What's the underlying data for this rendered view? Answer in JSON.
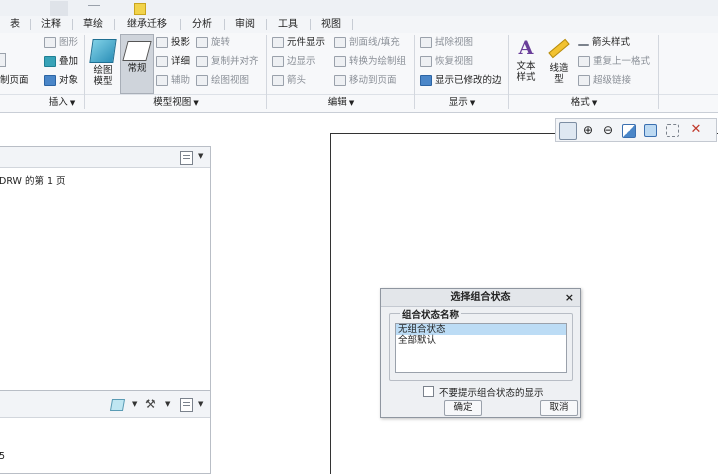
{
  "menu": {
    "tabs": [
      "表",
      "注释",
      "草绘",
      "继承迁移",
      "分析",
      "审阅",
      "工具",
      "视图"
    ]
  },
  "ribbon": {
    "groups": {
      "insert": {
        "label": "插入"
      },
      "model_views": {
        "label": "模型视图"
      },
      "edit": {
        "label": "编辑"
      },
      "display": {
        "label": "显示"
      },
      "format": {
        "label": "格式"
      }
    },
    "insert_items": {
      "graphics": "图形",
      "overlay": "叠加",
      "partial_left": "制页面",
      "object": "对象"
    },
    "model_views_items": {
      "drawing_model": "绘图模型",
      "general": "常规",
      "projection": "投影",
      "rotate": "旋转",
      "detail": "详细",
      "copy_align": "复制并对齐",
      "auxiliary": "辅助",
      "drawing_view": "绘图视图"
    },
    "edit_items": {
      "element_display": "元件显示",
      "section_hatch": "剖面线/填充",
      "edge_display": "边显示",
      "convert_to_drawing": "转换为绘制组",
      "arrow": "箭头",
      "move_to_page": "移动到页面"
    },
    "display_items": {
      "erase_view": "拭除视图",
      "restore_view": "恢复视图",
      "show_modified_edges": "显示已修改的边"
    },
    "format_items": {
      "text_style": "文本样式",
      "line_style": "线造型",
      "arrow_style": "箭头样式",
      "repeat_last_format": "重复上一格式",
      "hyperlink": "超级链接"
    }
  },
  "left_panel": {
    "tree_text": "DRW 的第 1 页",
    "bottom_text": "5"
  },
  "dialog": {
    "title": "选择组合状态",
    "close": "×",
    "group_label": "组合状态名称",
    "items": [
      "无组合状态",
      "全部默认"
    ],
    "selected_index": 0,
    "checkbox_label": "不要提示组合状态的显示",
    "checkbox_checked": false,
    "ok": "确定",
    "cancel": "取消"
  }
}
